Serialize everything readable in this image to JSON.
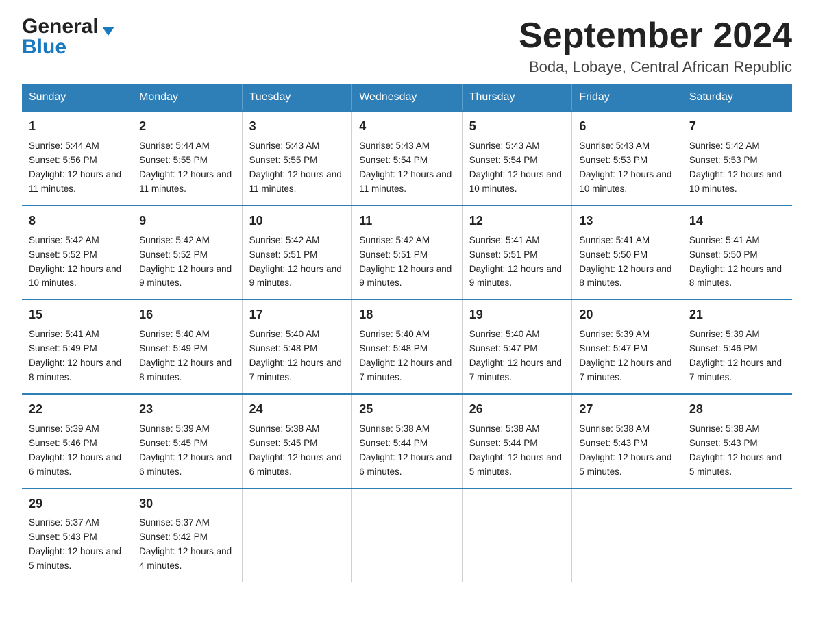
{
  "logo": {
    "general": "General",
    "blue": "Blue",
    "triangle": true
  },
  "title": "September 2024",
  "subtitle": "Boda, Lobaye, Central African Republic",
  "days": [
    "Sunday",
    "Monday",
    "Tuesday",
    "Wednesday",
    "Thursday",
    "Friday",
    "Saturday"
  ],
  "weeks": [
    [
      {
        "date": "1",
        "sunrise": "5:44 AM",
        "sunset": "5:56 PM",
        "daylight": "12 hours and 11 minutes."
      },
      {
        "date": "2",
        "sunrise": "5:44 AM",
        "sunset": "5:55 PM",
        "daylight": "12 hours and 11 minutes."
      },
      {
        "date": "3",
        "sunrise": "5:43 AM",
        "sunset": "5:55 PM",
        "daylight": "12 hours and 11 minutes."
      },
      {
        "date": "4",
        "sunrise": "5:43 AM",
        "sunset": "5:54 PM",
        "daylight": "12 hours and 11 minutes."
      },
      {
        "date": "5",
        "sunrise": "5:43 AM",
        "sunset": "5:54 PM",
        "daylight": "12 hours and 10 minutes."
      },
      {
        "date": "6",
        "sunrise": "5:43 AM",
        "sunset": "5:53 PM",
        "daylight": "12 hours and 10 minutes."
      },
      {
        "date": "7",
        "sunrise": "5:42 AM",
        "sunset": "5:53 PM",
        "daylight": "12 hours and 10 minutes."
      }
    ],
    [
      {
        "date": "8",
        "sunrise": "5:42 AM",
        "sunset": "5:52 PM",
        "daylight": "12 hours and 10 minutes."
      },
      {
        "date": "9",
        "sunrise": "5:42 AM",
        "sunset": "5:52 PM",
        "daylight": "12 hours and 9 minutes."
      },
      {
        "date": "10",
        "sunrise": "5:42 AM",
        "sunset": "5:51 PM",
        "daylight": "12 hours and 9 minutes."
      },
      {
        "date": "11",
        "sunrise": "5:42 AM",
        "sunset": "5:51 PM",
        "daylight": "12 hours and 9 minutes."
      },
      {
        "date": "12",
        "sunrise": "5:41 AM",
        "sunset": "5:51 PM",
        "daylight": "12 hours and 9 minutes."
      },
      {
        "date": "13",
        "sunrise": "5:41 AM",
        "sunset": "5:50 PM",
        "daylight": "12 hours and 8 minutes."
      },
      {
        "date": "14",
        "sunrise": "5:41 AM",
        "sunset": "5:50 PM",
        "daylight": "12 hours and 8 minutes."
      }
    ],
    [
      {
        "date": "15",
        "sunrise": "5:41 AM",
        "sunset": "5:49 PM",
        "daylight": "12 hours and 8 minutes."
      },
      {
        "date": "16",
        "sunrise": "5:40 AM",
        "sunset": "5:49 PM",
        "daylight": "12 hours and 8 minutes."
      },
      {
        "date": "17",
        "sunrise": "5:40 AM",
        "sunset": "5:48 PM",
        "daylight": "12 hours and 7 minutes."
      },
      {
        "date": "18",
        "sunrise": "5:40 AM",
        "sunset": "5:48 PM",
        "daylight": "12 hours and 7 minutes."
      },
      {
        "date": "19",
        "sunrise": "5:40 AM",
        "sunset": "5:47 PM",
        "daylight": "12 hours and 7 minutes."
      },
      {
        "date": "20",
        "sunrise": "5:39 AM",
        "sunset": "5:47 PM",
        "daylight": "12 hours and 7 minutes."
      },
      {
        "date": "21",
        "sunrise": "5:39 AM",
        "sunset": "5:46 PM",
        "daylight": "12 hours and 7 minutes."
      }
    ],
    [
      {
        "date": "22",
        "sunrise": "5:39 AM",
        "sunset": "5:46 PM",
        "daylight": "12 hours and 6 minutes."
      },
      {
        "date": "23",
        "sunrise": "5:39 AM",
        "sunset": "5:45 PM",
        "daylight": "12 hours and 6 minutes."
      },
      {
        "date": "24",
        "sunrise": "5:38 AM",
        "sunset": "5:45 PM",
        "daylight": "12 hours and 6 minutes."
      },
      {
        "date": "25",
        "sunrise": "5:38 AM",
        "sunset": "5:44 PM",
        "daylight": "12 hours and 6 minutes."
      },
      {
        "date": "26",
        "sunrise": "5:38 AM",
        "sunset": "5:44 PM",
        "daylight": "12 hours and 5 minutes."
      },
      {
        "date": "27",
        "sunrise": "5:38 AM",
        "sunset": "5:43 PM",
        "daylight": "12 hours and 5 minutes."
      },
      {
        "date": "28",
        "sunrise": "5:38 AM",
        "sunset": "5:43 PM",
        "daylight": "12 hours and 5 minutes."
      }
    ],
    [
      {
        "date": "29",
        "sunrise": "5:37 AM",
        "sunset": "5:43 PM",
        "daylight": "12 hours and 5 minutes."
      },
      {
        "date": "30",
        "sunrise": "5:37 AM",
        "sunset": "5:42 PM",
        "daylight": "12 hours and 4 minutes."
      },
      null,
      null,
      null,
      null,
      null
    ]
  ]
}
